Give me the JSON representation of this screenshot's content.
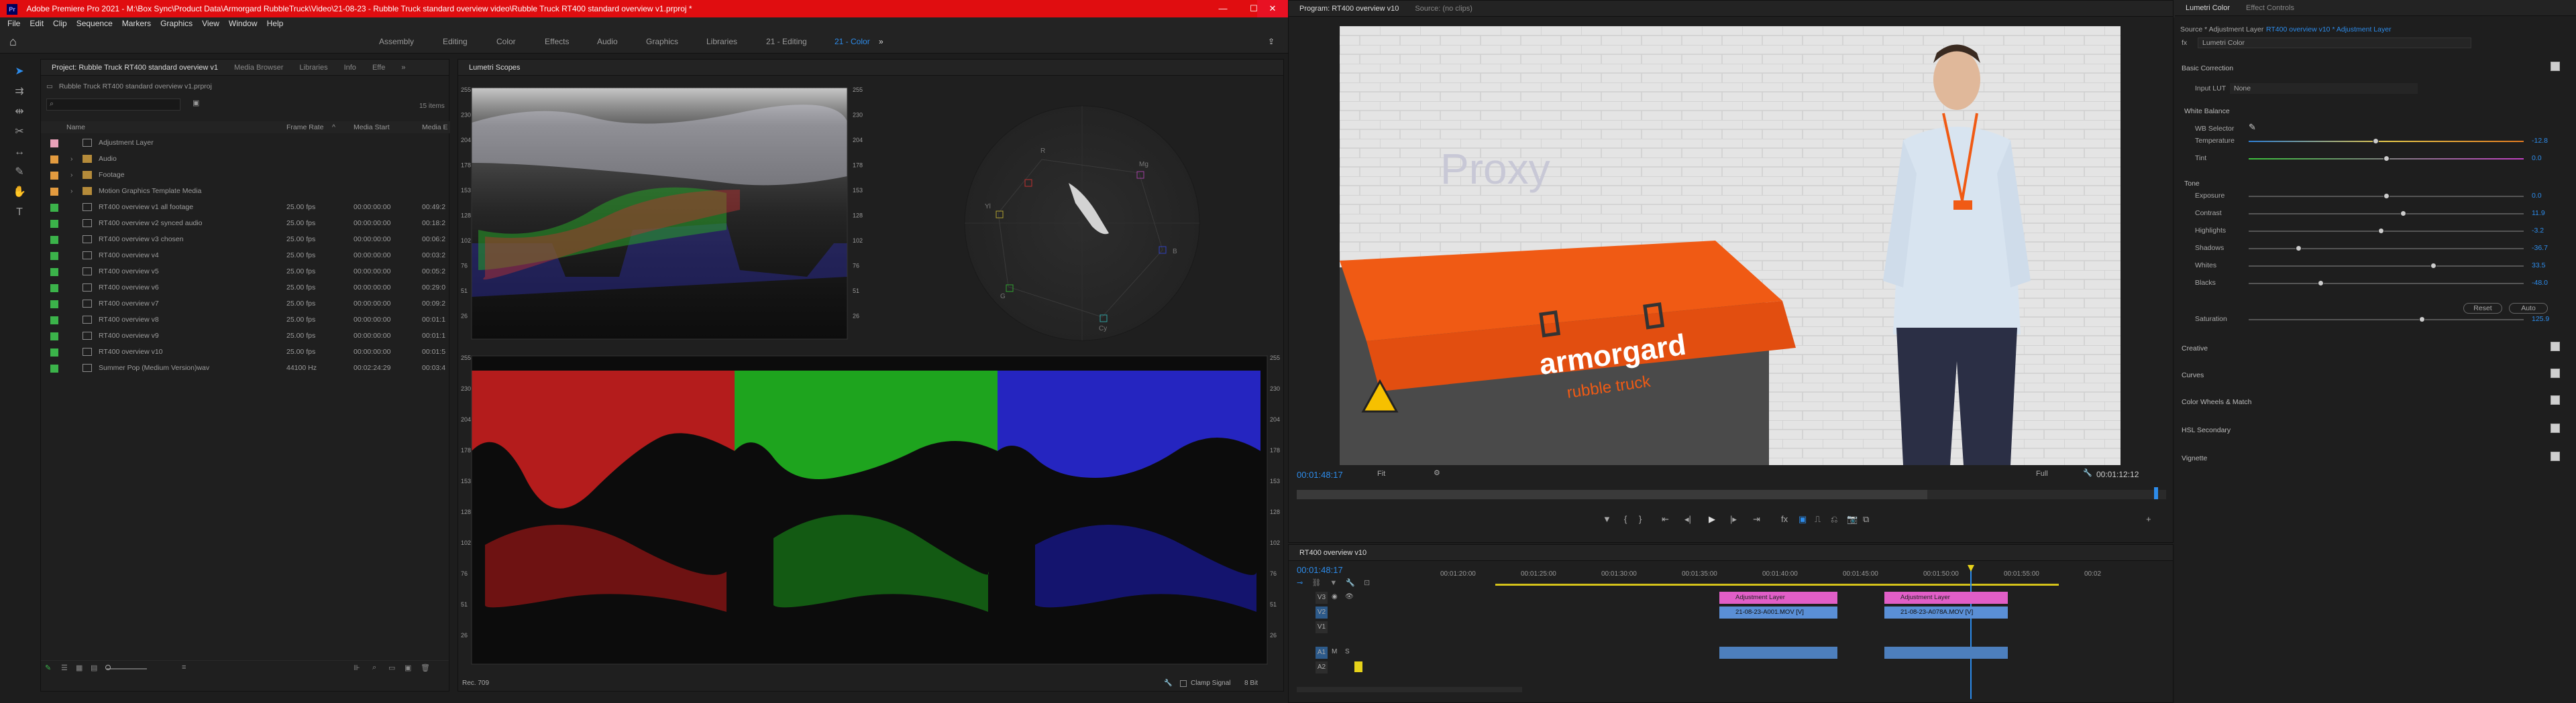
{
  "titlebar": {
    "app_icon": "Pr",
    "title": "Adobe Premiere Pro 2021 - M:\\Box Sync\\Product Data\\Armorgard RubbleTruck\\Video\\21-08-23 - Rubble Truck standard overview video\\Rubble Truck RT400 standard overview v1.prproj *",
    "minimize": "—",
    "maximize": "☐",
    "close": "✕"
  },
  "menu": [
    "File",
    "Edit",
    "Clip",
    "Sequence",
    "Markers",
    "Graphics",
    "View",
    "Window",
    "Help"
  ],
  "workspaces": {
    "items": [
      "Assembly",
      "Editing",
      "Color",
      "Effects",
      "Audio",
      "Graphics",
      "Libraries",
      "21 - Editing",
      "21 - Color"
    ],
    "active": "21 - Color",
    "more": "»"
  },
  "project": {
    "tabs": [
      "Project: Rubble Truck RT400 standard overview v1",
      "Media Browser",
      "Libraries",
      "Info",
      "Effe",
      "»"
    ],
    "file": "Rubble Truck RT400 standard overview v1.prproj",
    "items_count": "15 items",
    "columns": [
      "Name",
      "Frame Rate",
      "Media Start",
      "Media E"
    ],
    "rows": [
      {
        "name": "Adjustment Layer",
        "fps": "",
        "start": "",
        "end": "",
        "color": "#e8a1b8",
        "type": "adj"
      },
      {
        "name": "Audio",
        "fps": "",
        "start": "",
        "end": "",
        "color": "#e39b3f",
        "type": "bin"
      },
      {
        "name": "Footage",
        "fps": "",
        "start": "",
        "end": "",
        "color": "#e39b3f",
        "type": "bin"
      },
      {
        "name": "Motion Graphics Template Media",
        "fps": "",
        "start": "",
        "end": "",
        "color": "#e39b3f",
        "type": "bin"
      },
      {
        "name": "RT400 overview v1 all footage",
        "fps": "25.00 fps",
        "start": "00:00:00:00",
        "end": "00:49:2",
        "color": "#3bb34a",
        "type": "seq"
      },
      {
        "name": "RT400 overview v2 synced audio",
        "fps": "25.00 fps",
        "start": "00:00:00:00",
        "end": "00:18:2",
        "color": "#3bb34a",
        "type": "seq"
      },
      {
        "name": "RT400 overview v3 chosen",
        "fps": "25.00 fps",
        "start": "00:00:00:00",
        "end": "00:06:2",
        "color": "#3bb34a",
        "type": "seq"
      },
      {
        "name": "RT400 overview v4",
        "fps": "25.00 fps",
        "start": "00:00:00:00",
        "end": "00:03:2",
        "color": "#3bb34a",
        "type": "seq"
      },
      {
        "name": "RT400 overview v5",
        "fps": "25.00 fps",
        "start": "00:00:00:00",
        "end": "00:05:2",
        "color": "#3bb34a",
        "type": "seq"
      },
      {
        "name": "RT400 overview v6",
        "fps": "25.00 fps",
        "start": "00:00:00:00",
        "end": "00:29:0",
        "color": "#3bb34a",
        "type": "seq"
      },
      {
        "name": "RT400 overview v7",
        "fps": "25.00 fps",
        "start": "00:00:00:00",
        "end": "00:09:2",
        "color": "#3bb34a",
        "type": "seq"
      },
      {
        "name": "RT400 overview v8",
        "fps": "25.00 fps",
        "start": "00:00:00:00",
        "end": "00:01:1",
        "color": "#3bb34a",
        "type": "seq"
      },
      {
        "name": "RT400 overview v9",
        "fps": "25.00 fps",
        "start": "00:00:00:00",
        "end": "00:01:1",
        "color": "#3bb34a",
        "type": "seq"
      },
      {
        "name": "RT400 overview v10",
        "fps": "25.00 fps",
        "start": "00:00:00:00",
        "end": "00:01:5",
        "color": "#3bb34a",
        "type": "seq"
      },
      {
        "name": "Summer Pop (Medium Version)wav",
        "fps": "44100 Hz",
        "start": "00:02:24:29",
        "end": "00:03:4",
        "color": "#3bb34a",
        "type": "audio"
      }
    ]
  },
  "scopes": {
    "tab": "Lumetri Scopes",
    "footer_left": "Rec. 709",
    "clamp": "Clamp Signal",
    "bits": "8 Bit",
    "waveform_ticks": [
      "255",
      "230",
      "204",
      "178",
      "153",
      "128",
      "102",
      "76",
      "51",
      "26"
    ],
    "parade_ticks": [
      "255",
      "230",
      "204",
      "178",
      "153",
      "128",
      "102",
      "76",
      "51",
      "26"
    ],
    "vectorscope_labels": [
      "R",
      "Mg",
      "B",
      "Cy",
      "G",
      "Yl"
    ]
  },
  "program": {
    "tab": "Program: RT400 overview v10",
    "source_tab": "Source: (no clips)",
    "timecode": "00:01:48:17",
    "fit": "Fit",
    "full": "Full",
    "duration": "00:01:12:12",
    "watermark": "Proxy",
    "brand": "armorgard",
    "brand_sub": "rubble truck"
  },
  "timeline": {
    "tab": "RT400 overview v10",
    "timecode": "00:01:48:17",
    "ruler": [
      "00:01:20:00",
      "00:01:25:00",
      "00:01:30:00",
      "00:01:35:00",
      "00:01:40:00",
      "00:01:45:00",
      "00:01:50:00",
      "00:01:55:00",
      "00:02"
    ],
    "tracks": [
      "V3",
      "V2",
      "V1",
      "A1",
      "A2"
    ],
    "clips": {
      "adj1": "Adjustment Layer",
      "adj2": "Adjustment Layer",
      "v1a": "21-08-23-A001.MOV [V]",
      "v1b": "21-08-23-A078A.MOV [V]"
    }
  },
  "lumetri": {
    "tabs": [
      "Lumetri Color",
      "Effect Controls"
    ],
    "source": "Source * Adjustment Layer",
    "target": "RT400 overview v10 * Adjustment Layer",
    "fx": "Lumetri Color",
    "sections": {
      "basic": "Basic Correction",
      "input_lut_label": "Input LUT",
      "input_lut": "None",
      "wb": "White Balance",
      "wb_selector": "WB Selector",
      "tone": "Tone",
      "creative": "Creative",
      "curves": "Curves",
      "wheels": "Color Wheels & Match",
      "hsl": "HSL Secondary",
      "vignette": "Vignette"
    },
    "sliders": [
      {
        "label": "Temperature",
        "value": "-12.8",
        "pos": 0.46
      },
      {
        "label": "Tint",
        "value": "0.0",
        "pos": 0.5
      },
      {
        "label": "Exposure",
        "value": "0.0",
        "pos": 0.5
      },
      {
        "label": "Contrast",
        "value": "11.9",
        "pos": 0.56
      },
      {
        "label": "Highlights",
        "value": "-3.2",
        "pos": 0.48
      },
      {
        "label": "Shadows",
        "value": "-36.7",
        "pos": 0.18
      },
      {
        "label": "Whites",
        "value": "33.5",
        "pos": 0.67
      },
      {
        "label": "Blacks",
        "value": "-48.0",
        "pos": 0.26
      },
      {
        "label": "Saturation",
        "value": "125.9",
        "pos": 0.63
      }
    ],
    "reset": "Reset",
    "auto": "Auto"
  }
}
